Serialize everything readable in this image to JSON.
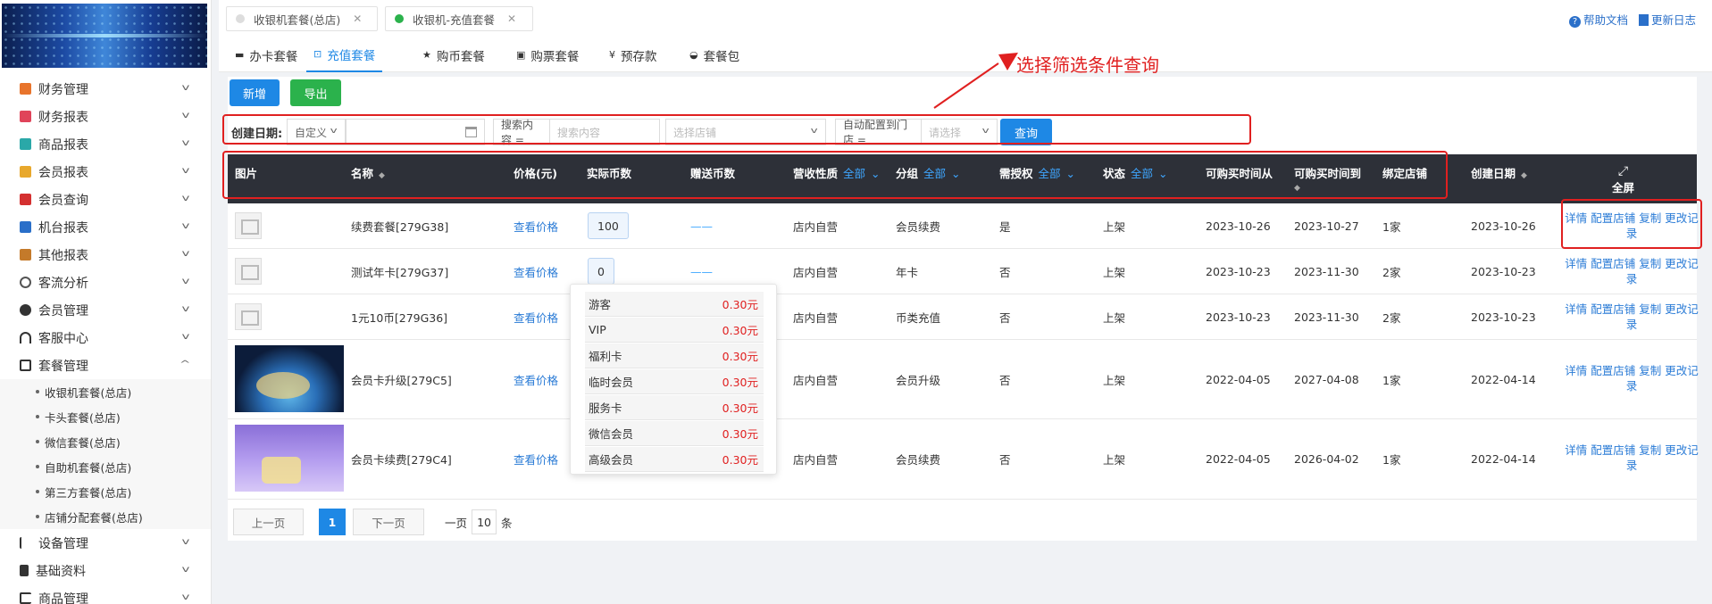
{
  "sidebar": {
    "menu": [
      {
        "label": "财务管理",
        "icon": "ledger-icon",
        "color": "#e8742c"
      },
      {
        "label": "财务报表",
        "icon": "report-icon",
        "color": "#e0445a"
      },
      {
        "label": "商品报表",
        "icon": "goods-report-icon",
        "color": "#2aa8a8"
      },
      {
        "label": "会员报表",
        "icon": "member-report-icon",
        "color": "#e8a82c"
      },
      {
        "label": "会员查询",
        "icon": "member-query-icon",
        "color": "#d43030"
      },
      {
        "label": "机台报表",
        "icon": "machine-report-icon",
        "color": "#2a6fc9"
      },
      {
        "label": "其他报表",
        "icon": "stack-icon",
        "color": "#c47a2a"
      },
      {
        "label": "客流分析",
        "icon": "target-icon",
        "color": "#555555"
      },
      {
        "label": "会员管理",
        "icon": "user-icon",
        "color": "#333333"
      },
      {
        "label": "客服中心",
        "icon": "headset-icon",
        "color": "#333333"
      },
      {
        "label": "套餐管理",
        "icon": "edit-icon",
        "color": "#333333"
      }
    ],
    "submenu": [
      "收银机套餐(总店)",
      "卡头套餐(总店)",
      "微信套餐(总店)",
      "自助机套餐(总店)",
      "第三方套餐(总店)",
      "店铺分配套餐(总店)"
    ],
    "menu_after": [
      {
        "label": "设备管理",
        "icon": "device-icon",
        "color": "#333333"
      },
      {
        "label": "基础资料",
        "icon": "file-icon",
        "color": "#333333"
      },
      {
        "label": "商品管理",
        "icon": "swap-icon",
        "color": "#333333"
      }
    ]
  },
  "tabs": [
    {
      "label": "收银机套餐(总店)",
      "dot_color": "#dddddd"
    },
    {
      "label": "收银机-充值套餐",
      "dot_color": "#2bb24c"
    }
  ],
  "help": {
    "doc": "帮助文档",
    "log": "更新日志"
  },
  "subtabs": [
    {
      "label": "办卡套餐",
      "icon": "minus-icon"
    },
    {
      "label": "充值套餐",
      "icon": "recharge-icon"
    },
    {
      "label": "购币套餐",
      "icon": "star-icon"
    },
    {
      "label": "购票套餐",
      "icon": "ticket-icon"
    },
    {
      "label": "预存款",
      "icon": "yen-icon"
    },
    {
      "label": "套餐包",
      "icon": "basket-icon"
    }
  ],
  "toolbar": {
    "add": "新增",
    "export": "导出"
  },
  "filter": {
    "date_label": "创建日期:",
    "date_mode": "自定义",
    "search_label": "搜索内容 =",
    "search_placeholder": "搜索内容",
    "store_placeholder": "选择店铺",
    "auto_label": "自动配置到门店 =",
    "auto_placeholder": "请选择",
    "query": "查询"
  },
  "annotation": "选择筛选条件查询",
  "table": {
    "headers": {
      "image": "图片",
      "name": "名称",
      "price": "价格(元)",
      "coins": "实际币数",
      "bonus": "赠送币数",
      "nature": "营收性质",
      "nature_f": "全部",
      "group": "分组",
      "group_f": "全部",
      "auth": "需授权",
      "auth_f": "全部",
      "status": "状态",
      "status_f": "全部",
      "from": "可购买时间从",
      "to": "可购买时间到",
      "store": "绑定店铺",
      "created": "创建日期",
      "fullscreen": "全屏"
    },
    "rows": [
      {
        "name": "续费套餐[279G38]",
        "price": "查看价格",
        "coins": "100",
        "bonus": "——",
        "nature": "店内自营",
        "group": "会员续费",
        "auth": "是",
        "status": "上架",
        "from": "2023-10-26",
        "to": "2023-10-27",
        "store": "1家",
        "created": "2023-10-26"
      },
      {
        "name": "测试年卡[279G37]",
        "price": "查看价格",
        "coins": "0",
        "bonus": "——",
        "nature": "店内自营",
        "group": "年卡",
        "auth": "否",
        "status": "上架",
        "from": "2023-10-23",
        "to": "2023-11-30",
        "store": "2家",
        "created": "2023-10-23"
      },
      {
        "name": "1元10币[279G36]",
        "price": "查看价格",
        "coins": "",
        "bonus": "",
        "nature": "店内自营",
        "group": "币类充值",
        "auth": "否",
        "status": "上架",
        "from": "2023-10-23",
        "to": "2023-11-30",
        "store": "2家",
        "created": "2023-10-23"
      },
      {
        "name": "会员卡升级[279C5]",
        "price": "查看价格",
        "coins": "",
        "bonus": "",
        "nature": "店内自营",
        "group": "会员升级",
        "auth": "否",
        "status": "上架",
        "from": "2022-04-05",
        "to": "2027-04-08",
        "store": "1家",
        "created": "2022-04-14"
      },
      {
        "name": "会员卡续费[279C4]",
        "price": "查看价格",
        "coins": "",
        "bonus": "",
        "nature": "店内自营",
        "group": "会员续费",
        "auth": "否",
        "status": "上架",
        "from": "2022-04-05",
        "to": "2026-04-02",
        "store": "1家",
        "created": "2022-04-14"
      }
    ],
    "actions": {
      "detail": "详情",
      "config": "配置店铺",
      "copy": "复制",
      "log": "更改记录"
    }
  },
  "popover": [
    {
      "label": "游客",
      "value": "0.30元"
    },
    {
      "label": "VIP",
      "value": "0.30元"
    },
    {
      "label": "福利卡",
      "value": "0.30元"
    },
    {
      "label": "临时会员",
      "value": "0.30元"
    },
    {
      "label": "服务卡",
      "value": "0.30元"
    },
    {
      "label": "微信会员",
      "value": "0.30元"
    },
    {
      "label": "高级会员",
      "value": "0.30元"
    }
  ],
  "pagination": {
    "prev": "上一页",
    "page": "1",
    "next": "下一页",
    "per_label": "一页",
    "per_value": "10",
    "per_unit": "条"
  }
}
